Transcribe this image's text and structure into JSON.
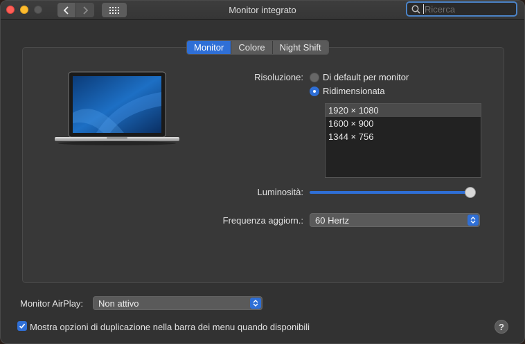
{
  "window": {
    "title": "Monitor integrato"
  },
  "toolbar": {
    "back_icon": "chevron-left",
    "forward_icon": "chevron-right",
    "grid_icon": "grid-dots"
  },
  "search": {
    "placeholder": "Ricerca",
    "icon": "search-icon"
  },
  "tabs": [
    {
      "label": "Monitor",
      "active": true
    },
    {
      "label": "Colore",
      "active": false
    },
    {
      "label": "Night Shift",
      "active": false
    }
  ],
  "resolution": {
    "label": "Risoluzione:",
    "options": [
      {
        "label": "Di default per monitor",
        "selected": false
      },
      {
        "label": "Ridimensionata",
        "selected": true
      }
    ],
    "list": [
      {
        "label": "1920 × 1080",
        "selected": true
      },
      {
        "label": "1600 × 900",
        "selected": false
      },
      {
        "label": "1344 × 756",
        "selected": false
      }
    ]
  },
  "brightness": {
    "label": "Luminosità:",
    "level": 1.0
  },
  "refresh": {
    "label": "Frequenza aggiorn.:",
    "value": "60 Hertz"
  },
  "airplay": {
    "label": "Monitor AirPlay:",
    "value": "Non attivo"
  },
  "mirroring": {
    "label": "Mostra opzioni di duplicazione nella barra dei menu quando disponibili",
    "checked": true
  },
  "help": {
    "label": "?"
  },
  "colors": {
    "accent": "#2f6fd6",
    "close": "#ff5f57",
    "minimize": "#febc2e"
  }
}
